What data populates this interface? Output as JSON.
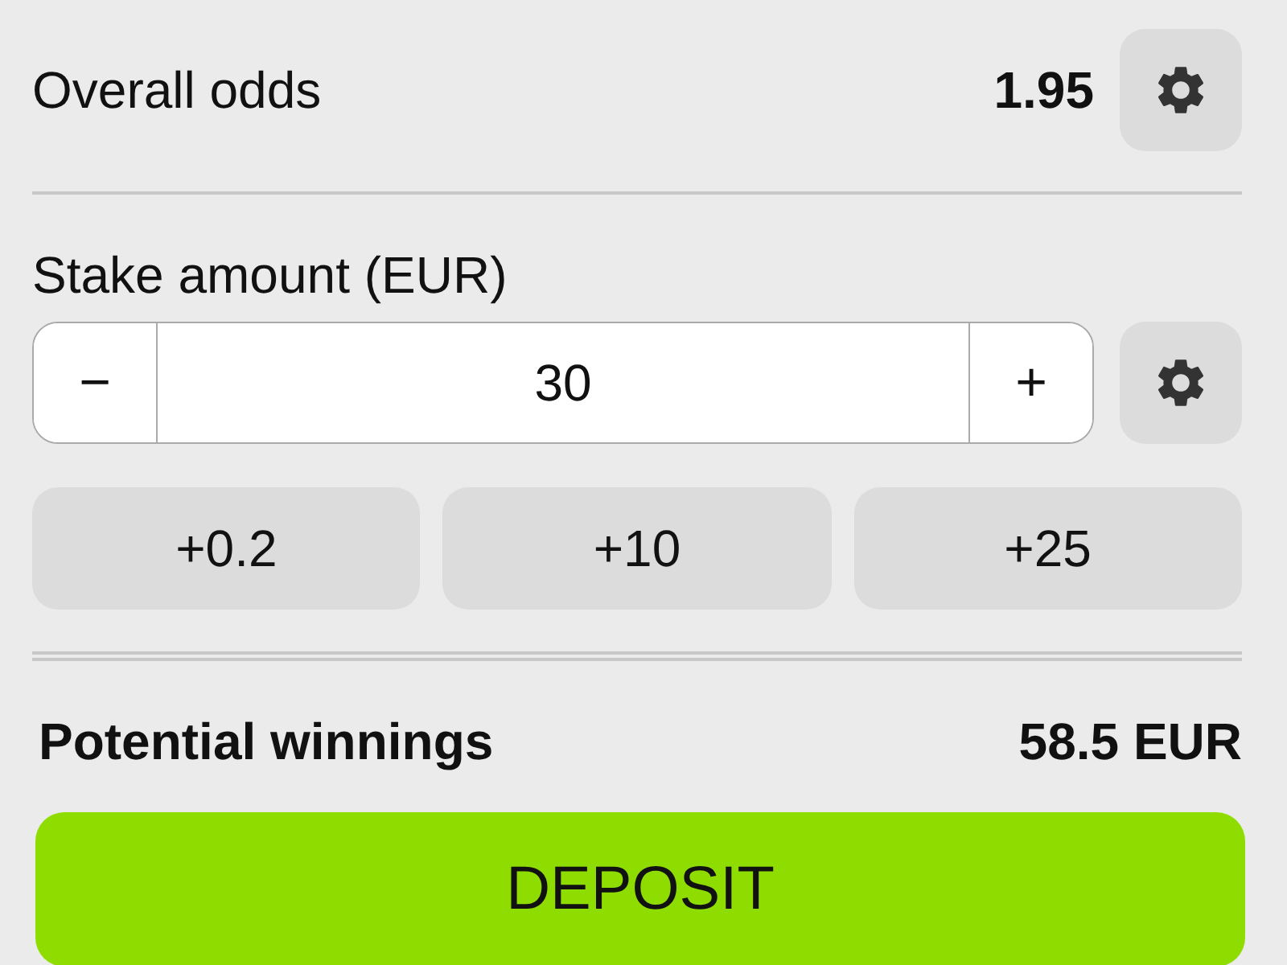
{
  "overall_odds": {
    "label": "Overall odds",
    "value": "1.95"
  },
  "stake": {
    "label": "Stake amount (EUR)",
    "decrement": "−",
    "value": "30",
    "increment": "+"
  },
  "quick_amounts": [
    "+0.2",
    "+10",
    "+25"
  ],
  "potential_winnings": {
    "label": "Potential winnings",
    "value": "58.5 EUR"
  },
  "deposit_button": "DEPOSIT"
}
